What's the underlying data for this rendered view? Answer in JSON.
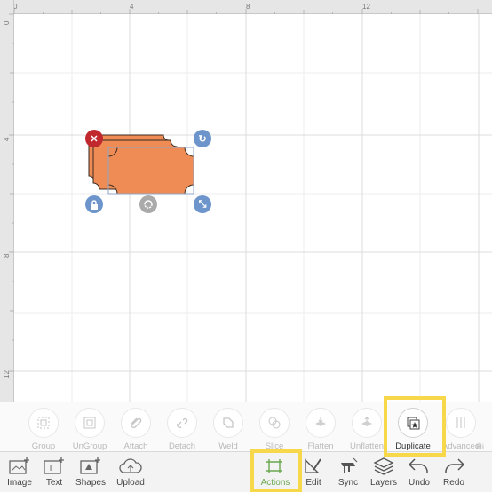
{
  "ruler": {
    "top_marks": [
      "0",
      "4",
      "8",
      "12"
    ],
    "left_marks": [
      "0",
      "4",
      "8",
      "12"
    ]
  },
  "canvas": {
    "shape_fill": "#ef8c55",
    "shape_stroke": "#3a2a20",
    "handles": {
      "delete": "delete-icon",
      "rotate": "rotate-icon",
      "lock": "lock-icon",
      "flip": "flip-icon",
      "resize": "resize-icon"
    }
  },
  "action_bar": {
    "items": [
      {
        "label": "Group",
        "icon": "group-icon"
      },
      {
        "label": "UnGroup",
        "icon": "ungroup-icon"
      },
      {
        "label": "Attach",
        "icon": "attach-icon"
      },
      {
        "label": "Detach",
        "icon": "detach-icon"
      },
      {
        "label": "Weld",
        "icon": "weld-icon"
      },
      {
        "label": "Slice",
        "icon": "slice-icon"
      },
      {
        "label": "Flatten",
        "icon": "flatten-icon"
      },
      {
        "label": "Unflatten",
        "icon": "unflatten-icon"
      },
      {
        "label": "Duplicate",
        "icon": "duplicate-icon"
      },
      {
        "label": "Advanced",
        "icon": "advanced-icon"
      },
      {
        "label": "Hi",
        "icon": "hide-icon"
      }
    ]
  },
  "toolbar": {
    "items": [
      {
        "label": "Image",
        "icon": "image-add-icon"
      },
      {
        "label": "Text",
        "icon": "text-add-icon"
      },
      {
        "label": "Shapes",
        "icon": "shapes-add-icon"
      },
      {
        "label": "Upload",
        "icon": "upload-cloud-icon"
      },
      {
        "label": "Actions",
        "icon": "actions-icon"
      },
      {
        "label": "Edit",
        "icon": "edit-icon"
      },
      {
        "label": "Sync",
        "icon": "sync-icon"
      },
      {
        "label": "Layers",
        "icon": "layers-icon"
      },
      {
        "label": "Undo",
        "icon": "undo-icon"
      },
      {
        "label": "Redo",
        "icon": "redo-icon"
      }
    ]
  },
  "colors": {
    "highlight": "#f7d84a",
    "active_tab": "#6aa84f",
    "handle_blue": "#6d95cc",
    "delete_red": "#c0282e"
  }
}
